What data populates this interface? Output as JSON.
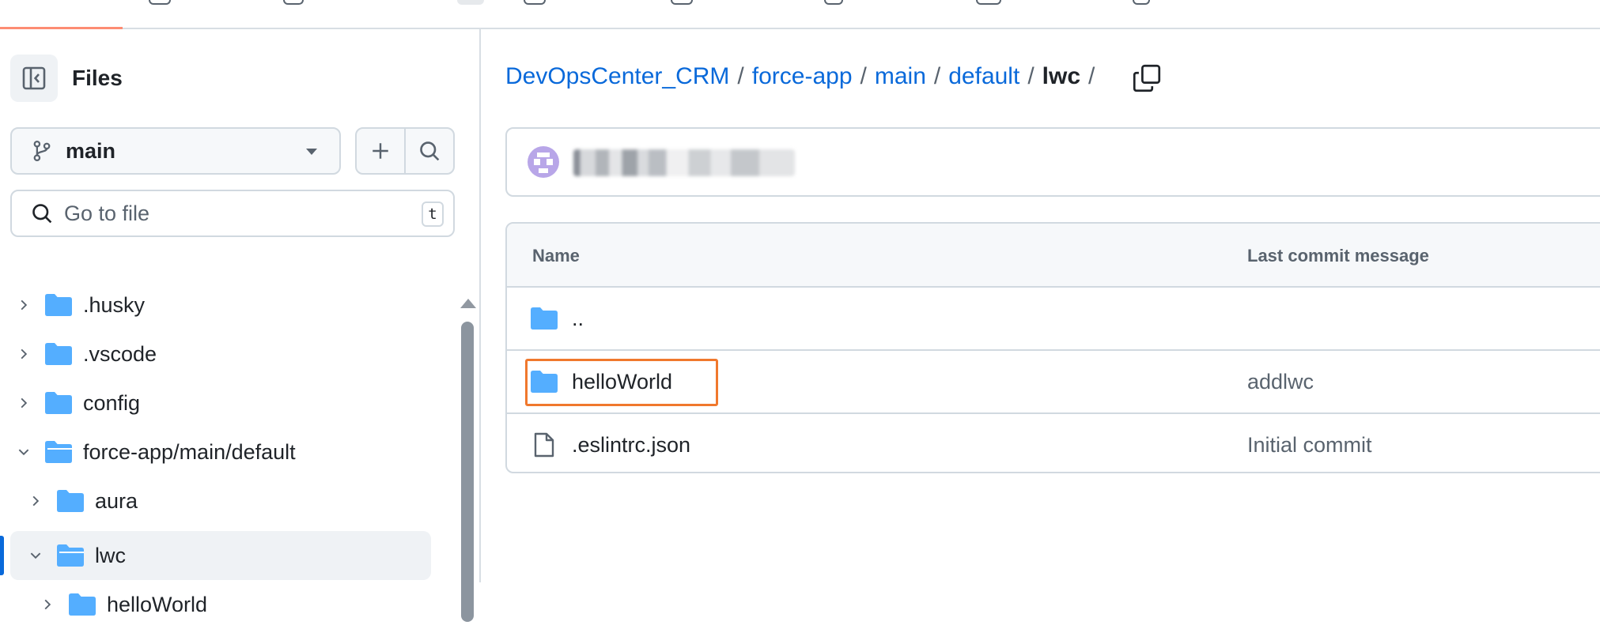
{
  "sidebar": {
    "title": "Files",
    "branch": "main",
    "search_placeholder": "Go to file",
    "search_shortcut": "t",
    "tree": [
      {
        "label": ".husky",
        "expanded": false
      },
      {
        "label": ".vscode",
        "expanded": false
      },
      {
        "label": "config",
        "expanded": false
      },
      {
        "label": "force-app/main/default",
        "expanded": true
      },
      {
        "label": "aura",
        "expanded": false
      },
      {
        "label": "lwc",
        "expanded": true,
        "selected": true
      },
      {
        "label": "helloWorld",
        "expanded": false
      }
    ]
  },
  "breadcrumb": {
    "repo": "DevOpsCenter_CRM",
    "parts": [
      "force-app",
      "main",
      "default"
    ],
    "current": "lwc",
    "separator": "/"
  },
  "table": {
    "headers": {
      "name": "Name",
      "message": "Last commit message"
    },
    "rows": [
      {
        "name": "..",
        "type": "folder",
        "message": ""
      },
      {
        "name": "helloWorld",
        "type": "folder",
        "message": "addlwc",
        "highlighted": true
      },
      {
        "name": ".eslintrc.json",
        "type": "file",
        "message": "Initial commit"
      }
    ]
  },
  "colors": {
    "link": "#0969da",
    "folder": "#54aeff",
    "highlight": "#f0782d",
    "accent": "#fd8c73"
  }
}
